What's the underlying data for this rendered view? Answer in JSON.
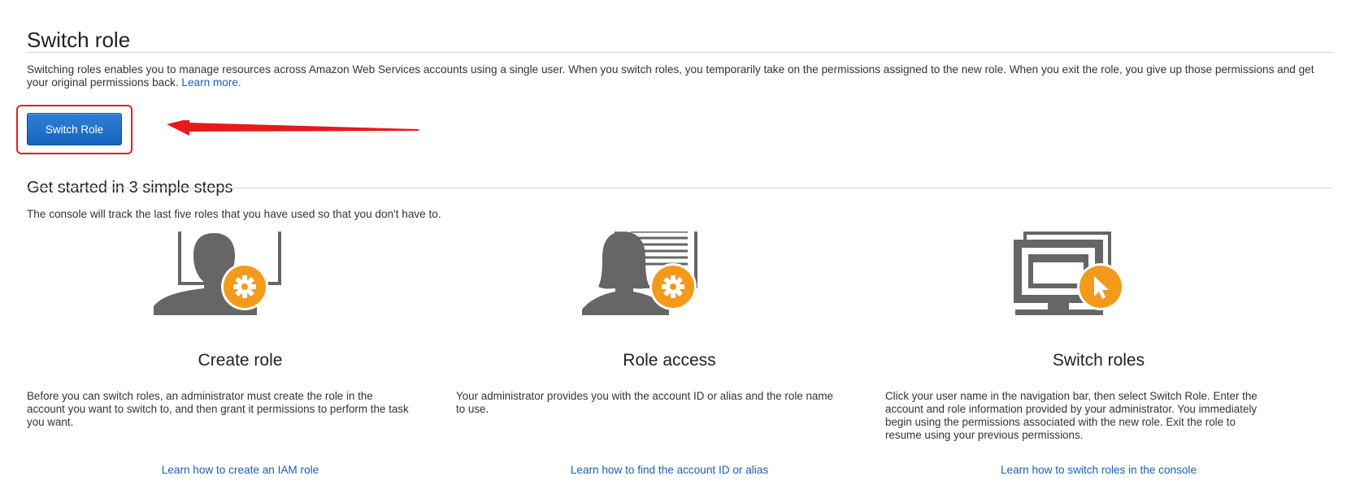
{
  "header": {
    "title": "Switch role",
    "intro": "Switching roles enables you to manage resources across Amazon Web Services accounts using a single user. When you switch roles, you temporarily take on the permissions assigned to the new role. When you exit the role, you give up those permissions and get your original permissions back.",
    "learn_more": "Learn more."
  },
  "actions": {
    "switch_role_label": "Switch Role"
  },
  "annotation": {
    "highlight_color": "#e02020"
  },
  "steps_section": {
    "title": "Get started in 3 simple steps",
    "subtitle": "The console will track the last five roles that you have used so that you don't have to."
  },
  "steps": [
    {
      "icon": "user-lock-gear-icon",
      "title": "Create role",
      "description": "Before you can switch roles, an administrator must create the role in the account you want to switch to, and then grant it permissions to perform the task you want.",
      "link": "Learn how to create an IAM role"
    },
    {
      "icon": "user-document-gear-icon",
      "title": "Role access",
      "description": "Your administrator provides you with the account ID or alias and the role name to use.",
      "link": "Learn how to find the account ID or alias"
    },
    {
      "icon": "monitor-cursor-icon",
      "title": "Switch roles",
      "description": "Click your user name in the navigation bar, then select Switch Role. Enter the account and role information provided by your administrator. You immediately begin using the permissions associated with the new role. Exit the role to resume using your previous permissions.",
      "link": "Learn how to switch roles in the console"
    }
  ],
  "colors": {
    "accent_orange": "#f49a1a",
    "icon_gray": "#666666",
    "link_blue": "#1a5fb4",
    "button_blue": "#1f6fc9"
  }
}
